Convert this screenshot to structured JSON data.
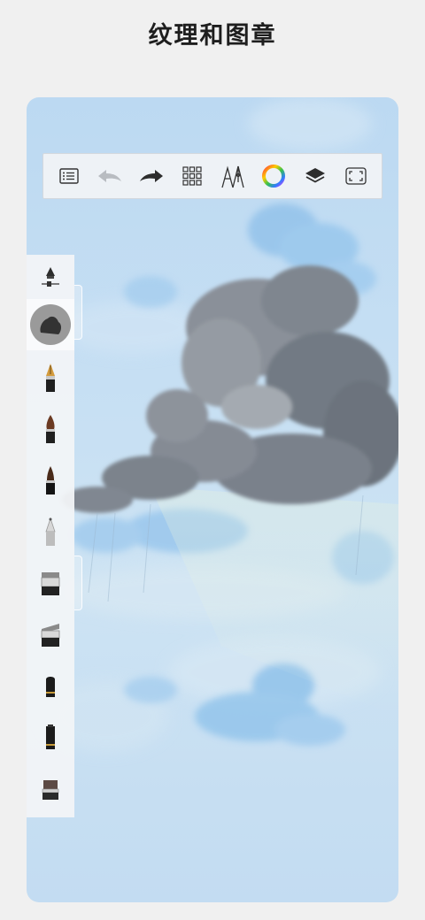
{
  "page": {
    "title": "纹理和图章"
  },
  "toolbar": {
    "items": [
      {
        "name": "gallery-list"
      },
      {
        "name": "undo"
      },
      {
        "name": "redo"
      },
      {
        "name": "brush-library"
      },
      {
        "name": "pen-tools"
      },
      {
        "name": "color-picker"
      },
      {
        "name": "layers"
      },
      {
        "name": "fullscreen"
      }
    ]
  },
  "sidebar": {
    "brushes": [
      "fountain-pen",
      "brush-round",
      "brush-ink",
      "airbrush",
      "stamp-wide",
      "stamp-angled",
      "marker-short",
      "marker-tall",
      "eraser"
    ]
  },
  "colors": {
    "background": "#f0f0f0",
    "sky": "#c3dcf2",
    "cloud_dark": "#7d848f",
    "cloud_blue": "#8fc2ec",
    "toolbar": "#f1f3f6"
  }
}
